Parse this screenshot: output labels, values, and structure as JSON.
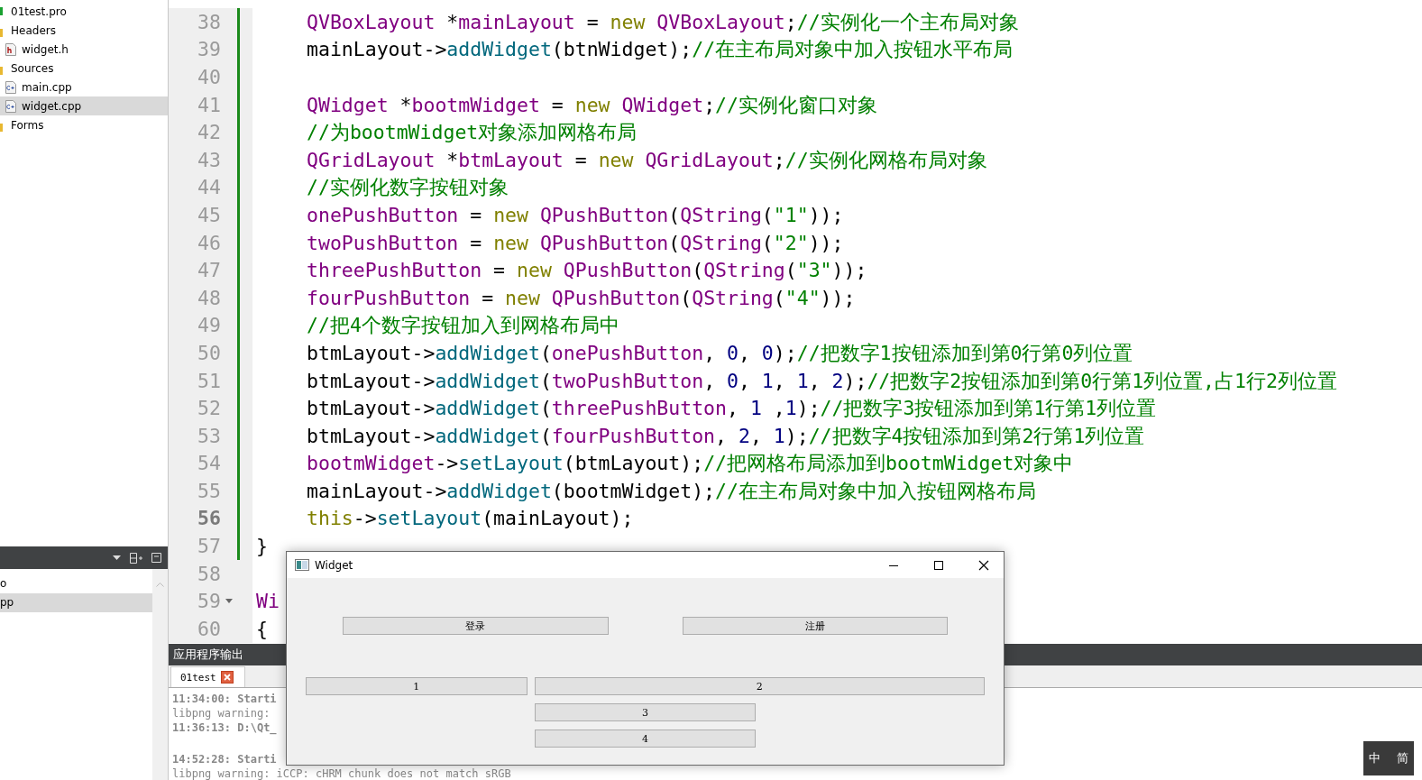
{
  "project_tree": [
    {
      "label": "01test.pro",
      "kind": "project",
      "selected": false
    },
    {
      "label": "Headers",
      "kind": "folder",
      "selected": false,
      "children": [
        {
          "label": "widget.h",
          "kind": "header",
          "selected": false
        }
      ]
    },
    {
      "label": "Sources",
      "kind": "folder",
      "selected": false,
      "children": [
        {
          "label": "main.cpp",
          "kind": "source",
          "selected": false
        },
        {
          "label": "widget.cpp",
          "kind": "source",
          "selected": true
        }
      ]
    },
    {
      "label": "Forms",
      "kind": "folder",
      "selected": false
    }
  ],
  "open_documents": [
    {
      "label": "o",
      "selected": false
    },
    {
      "label": "pp",
      "selected": true
    }
  ],
  "editor": {
    "lines": [
      {
        "number": "38",
        "current": false,
        "modified": true,
        "foldable": false,
        "indented": true,
        "tokens": [
          {
            "kind": "type",
            "text": "QVBoxLayout"
          },
          {
            "kind": "plain",
            "text": " *"
          },
          {
            "kind": "type",
            "text": "mainLayout"
          },
          {
            "kind": "plain",
            "text": " = "
          },
          {
            "kind": "keyword",
            "text": "new "
          },
          {
            "kind": "type",
            "text": "QVBoxLayout"
          },
          {
            "kind": "plain",
            "text": ";"
          },
          {
            "kind": "comment",
            "text": "//实例化一个主布局对象"
          }
        ]
      },
      {
        "number": "39",
        "current": false,
        "modified": true,
        "foldable": false,
        "indented": true,
        "tokens": [
          {
            "kind": "plain",
            "text": "mainLayout->"
          },
          {
            "kind": "function",
            "text": "addWidget"
          },
          {
            "kind": "plain",
            "text": "(btnWidget);"
          },
          {
            "kind": "comment",
            "text": "//在主布局对象中加入按钮水平布局"
          }
        ]
      },
      {
        "number": "40",
        "current": false,
        "modified": true,
        "foldable": false
      },
      {
        "number": "41",
        "current": false,
        "modified": true,
        "foldable": false,
        "indented": true,
        "tokens": [
          {
            "kind": "type",
            "text": "QWidget"
          },
          {
            "kind": "plain",
            "text": " *"
          },
          {
            "kind": "type",
            "text": "bootmWidget"
          },
          {
            "kind": "plain",
            "text": " = "
          },
          {
            "kind": "keyword",
            "text": "new "
          },
          {
            "kind": "type",
            "text": "QWidget"
          },
          {
            "kind": "plain",
            "text": ";"
          },
          {
            "kind": "comment",
            "text": "//实例化窗口对象"
          }
        ]
      },
      {
        "number": "42",
        "current": false,
        "modified": true,
        "foldable": false,
        "indented": true,
        "tokens": [
          {
            "kind": "comment",
            "text": "//为bootmWidget对象添加网格布局"
          }
        ]
      },
      {
        "number": "43",
        "current": false,
        "modified": true,
        "foldable": false,
        "indented": true,
        "tokens": [
          {
            "kind": "type",
            "text": "QGridLayout"
          },
          {
            "kind": "plain",
            "text": " *"
          },
          {
            "kind": "type",
            "text": "btmLayout"
          },
          {
            "kind": "plain",
            "text": " = "
          },
          {
            "kind": "keyword",
            "text": "new "
          },
          {
            "kind": "type",
            "text": "QGridLayout"
          },
          {
            "kind": "plain",
            "text": ";"
          },
          {
            "kind": "comment",
            "text": "//实例化网格布局对象"
          }
        ]
      },
      {
        "number": "44",
        "current": false,
        "modified": true,
        "foldable": false,
        "indented": true,
        "tokens": [
          {
            "kind": "comment",
            "text": "//实例化数字按钮对象"
          }
        ]
      },
      {
        "number": "45",
        "current": false,
        "modified": true,
        "foldable": false,
        "indented": true,
        "tokens": [
          {
            "kind": "type",
            "text": "onePushButton"
          },
          {
            "kind": "plain",
            "text": " = "
          },
          {
            "kind": "keyword",
            "text": "new "
          },
          {
            "kind": "type",
            "text": "QPushButton"
          },
          {
            "kind": "plain",
            "text": "("
          },
          {
            "kind": "type",
            "text": "QString"
          },
          {
            "kind": "plain",
            "text": "("
          },
          {
            "kind": "string",
            "text": "\"1\""
          },
          {
            "kind": "plain",
            "text": "));"
          }
        ]
      },
      {
        "number": "46",
        "current": false,
        "modified": true,
        "foldable": false,
        "indented": true,
        "tokens": [
          {
            "kind": "type",
            "text": "twoPushButton"
          },
          {
            "kind": "plain",
            "text": " = "
          },
          {
            "kind": "keyword",
            "text": "new "
          },
          {
            "kind": "type",
            "text": "QPushButton"
          },
          {
            "kind": "plain",
            "text": "("
          },
          {
            "kind": "type",
            "text": "QString"
          },
          {
            "kind": "plain",
            "text": "("
          },
          {
            "kind": "string",
            "text": "\"2\""
          },
          {
            "kind": "plain",
            "text": "));"
          }
        ]
      },
      {
        "number": "47",
        "current": false,
        "modified": true,
        "foldable": false,
        "indented": true,
        "tokens": [
          {
            "kind": "type",
            "text": "threePushButton"
          },
          {
            "kind": "plain",
            "text": " = "
          },
          {
            "kind": "keyword",
            "text": "new "
          },
          {
            "kind": "type",
            "text": "QPushButton"
          },
          {
            "kind": "plain",
            "text": "("
          },
          {
            "kind": "type",
            "text": "QString"
          },
          {
            "kind": "plain",
            "text": "("
          },
          {
            "kind": "string",
            "text": "\"3\""
          },
          {
            "kind": "plain",
            "text": "));"
          }
        ]
      },
      {
        "number": "48",
        "current": false,
        "modified": true,
        "foldable": false,
        "indented": true,
        "tokens": [
          {
            "kind": "type",
            "text": "fourPushButton"
          },
          {
            "kind": "plain",
            "text": " = "
          },
          {
            "kind": "keyword",
            "text": "new "
          },
          {
            "kind": "type",
            "text": "QPushButton"
          },
          {
            "kind": "plain",
            "text": "("
          },
          {
            "kind": "type",
            "text": "QString"
          },
          {
            "kind": "plain",
            "text": "("
          },
          {
            "kind": "string",
            "text": "\"4\""
          },
          {
            "kind": "plain",
            "text": "));"
          }
        ]
      },
      {
        "number": "49",
        "current": false,
        "modified": true,
        "foldable": false,
        "indented": true,
        "tokens": [
          {
            "kind": "comment",
            "text": "//把4个数字按钮加入到网格布局中"
          }
        ]
      },
      {
        "number": "50",
        "current": false,
        "modified": true,
        "foldable": false,
        "indented": true,
        "tokens": [
          {
            "kind": "plain",
            "text": "btmLayout->"
          },
          {
            "kind": "function",
            "text": "addWidget"
          },
          {
            "kind": "plain",
            "text": "("
          },
          {
            "kind": "type",
            "text": "onePushButton"
          },
          {
            "kind": "plain",
            "text": ", "
          },
          {
            "kind": "number",
            "text": "0"
          },
          {
            "kind": "plain",
            "text": ", "
          },
          {
            "kind": "number",
            "text": "0"
          },
          {
            "kind": "plain",
            "text": ");"
          },
          {
            "kind": "comment",
            "text": "//把数字1按钮添加到第0行第0列位置"
          }
        ]
      },
      {
        "number": "51",
        "current": false,
        "modified": true,
        "foldable": false,
        "indented": true,
        "tokens": [
          {
            "kind": "plain",
            "text": "btmLayout->"
          },
          {
            "kind": "function",
            "text": "addWidget"
          },
          {
            "kind": "plain",
            "text": "("
          },
          {
            "kind": "type",
            "text": "twoPushButton"
          },
          {
            "kind": "plain",
            "text": ", "
          },
          {
            "kind": "number",
            "text": "0"
          },
          {
            "kind": "plain",
            "text": ", "
          },
          {
            "kind": "number",
            "text": "1"
          },
          {
            "kind": "plain",
            "text": ", "
          },
          {
            "kind": "number",
            "text": "1"
          },
          {
            "kind": "plain",
            "text": ", "
          },
          {
            "kind": "number",
            "text": "2"
          },
          {
            "kind": "plain",
            "text": ");"
          },
          {
            "kind": "comment",
            "text": "//把数字2按钮添加到第0行第1列位置,占1行2列位置"
          }
        ]
      },
      {
        "number": "52",
        "current": false,
        "modified": true,
        "foldable": false,
        "indented": true,
        "tokens": [
          {
            "kind": "plain",
            "text": "btmLayout->"
          },
          {
            "kind": "function",
            "text": "addWidget"
          },
          {
            "kind": "plain",
            "text": "("
          },
          {
            "kind": "type",
            "text": "threePushButton"
          },
          {
            "kind": "plain",
            "text": ", "
          },
          {
            "kind": "number",
            "text": "1"
          },
          {
            "kind": "plain",
            "text": " ,"
          },
          {
            "kind": "number",
            "text": "1"
          },
          {
            "kind": "plain",
            "text": ");"
          },
          {
            "kind": "comment",
            "text": "//把数字3按钮添加到第1行第1列位置"
          }
        ]
      },
      {
        "number": "53",
        "current": false,
        "modified": true,
        "foldable": false,
        "indented": true,
        "tokens": [
          {
            "kind": "plain",
            "text": "btmLayout->"
          },
          {
            "kind": "function",
            "text": "addWidget"
          },
          {
            "kind": "plain",
            "text": "("
          },
          {
            "kind": "type",
            "text": "fourPushButton"
          },
          {
            "kind": "plain",
            "text": ", "
          },
          {
            "kind": "number",
            "text": "2"
          },
          {
            "kind": "plain",
            "text": ", "
          },
          {
            "kind": "number",
            "text": "1"
          },
          {
            "kind": "plain",
            "text": ");"
          },
          {
            "kind": "comment",
            "text": "//把数字4按钮添加到第2行第1列位置"
          }
        ]
      },
      {
        "number": "54",
        "current": false,
        "modified": true,
        "foldable": false,
        "indented": true,
        "tokens": [
          {
            "kind": "type",
            "text": "bootmWidget"
          },
          {
            "kind": "plain",
            "text": "->"
          },
          {
            "kind": "function",
            "text": "setLayout"
          },
          {
            "kind": "plain",
            "text": "(btmLayout);"
          },
          {
            "kind": "comment",
            "text": "//把网格布局添加到bootmWidget对象中"
          }
        ]
      },
      {
        "number": "55",
        "current": false,
        "modified": true,
        "foldable": false,
        "indented": true,
        "tokens": [
          {
            "kind": "plain",
            "text": "mainLayout->"
          },
          {
            "kind": "function",
            "text": "addWidget"
          },
          {
            "kind": "plain",
            "text": "(bootmWidget);"
          },
          {
            "kind": "comment",
            "text": "//在主布局对象中加入按钮网格布局"
          }
        ]
      },
      {
        "number": "56",
        "current": true,
        "modified": true,
        "foldable": false,
        "indented": true,
        "tokens": [
          {
            "kind": "keyword",
            "text": "this"
          },
          {
            "kind": "plain",
            "text": "->"
          },
          {
            "kind": "function",
            "text": "setLayout"
          },
          {
            "kind": "plain",
            "text": "(mainLayout);"
          }
        ]
      },
      {
        "number": "57",
        "current": false,
        "modified": true,
        "foldable": false,
        "indented": false,
        "tokens": [
          {
            "kind": "plain",
            "text": "}"
          }
        ]
      },
      {
        "number": "58",
        "current": false,
        "modified": false,
        "foldable": false
      },
      {
        "number": "59",
        "current": false,
        "modified": false,
        "foldable": true,
        "indented": false,
        "tokens": [
          {
            "kind": "type",
            "text": "Wi"
          }
        ]
      },
      {
        "number": "60",
        "current": false,
        "modified": false,
        "foldable": false,
        "indented": false,
        "tokens": [
          {
            "kind": "plain",
            "text": "{"
          }
        ]
      }
    ]
  },
  "output_pane": {
    "title": "应用程序输出",
    "tabs": [
      {
        "label": "01test",
        "selected": true
      }
    ],
    "log": [
      {
        "text": "11:34:00: Starti",
        "kind": "status"
      },
      {
        "text": "libpng warning:",
        "kind": "message"
      },
      {
        "text": "11:36:13: D:\\Qt_",
        "kind": "status"
      },
      {
        "text": "14:52:28: Starti",
        "kind": "status",
        "spaced": true
      },
      {
        "text": "libpng warning: iCCP: cHRM chunk does not match sRGB",
        "kind": "message"
      }
    ]
  },
  "widget_window": {
    "title": "Widget",
    "top_buttons": [
      "登录",
      "注册"
    ],
    "grid_buttons": [
      {
        "label": "1",
        "kind": "left"
      },
      {
        "label": "2",
        "kind": "wide"
      },
      {
        "label": "3",
        "kind": "middle"
      },
      {
        "label": "4",
        "kind": "middle"
      }
    ]
  },
  "ime_indicator": {
    "mode": "中",
    "script": "简"
  }
}
